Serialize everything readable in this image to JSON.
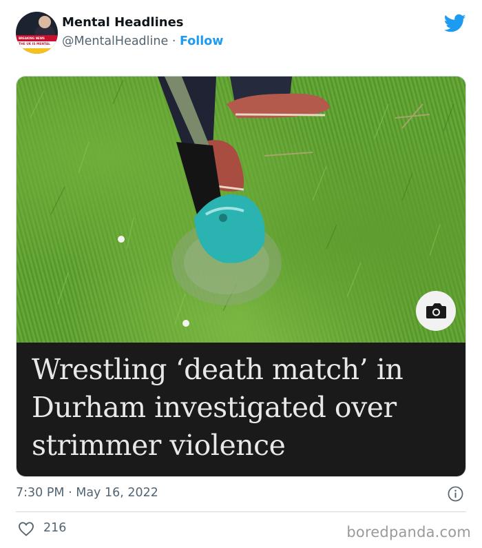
{
  "author": {
    "name": "Mental Headlines",
    "handle": "@MentalHeadline",
    "separator": " · ",
    "follow_label": "Follow",
    "avatar": {
      "banner_top": "BREAKING NEWS",
      "banner_main": "THE UK IS MENTAL"
    }
  },
  "media": {
    "headline": "Wrestling ‘death match’ in Durham investigated over strimmer violence"
  },
  "meta": {
    "time": "7:30 PM",
    "date_separator": " · ",
    "date": "May 16, 2022"
  },
  "actions": {
    "like_count": "216"
  },
  "watermark": "boredpanda.com",
  "colors": {
    "accent": "#1d9bf0",
    "secondary_text": "#536471",
    "caption_bg": "#1a1a1a"
  },
  "icons": [
    "twitter-bird-icon",
    "camera-icon",
    "info-icon",
    "heart-icon"
  ]
}
